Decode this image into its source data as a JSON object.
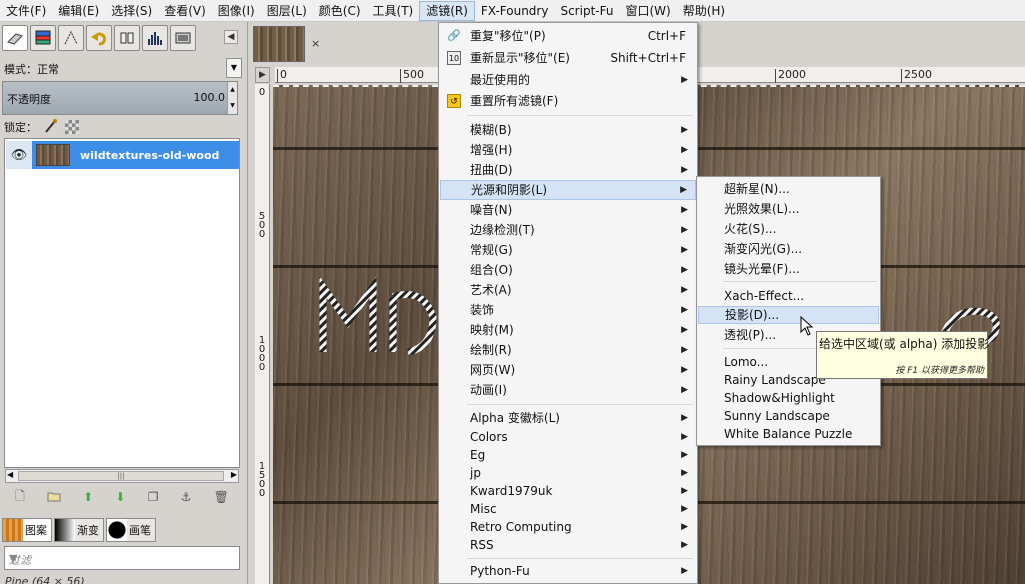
{
  "menubar": [
    {
      "label": "文件(F)"
    },
    {
      "label": "编辑(E)"
    },
    {
      "label": "选择(S)"
    },
    {
      "label": "查看(V)"
    },
    {
      "label": "图像(I)"
    },
    {
      "label": "图层(L)"
    },
    {
      "label": "颜色(C)"
    },
    {
      "label": "工具(T)"
    },
    {
      "label": "滤镜(R)",
      "active": true
    },
    {
      "label": "FX-Foundry"
    },
    {
      "label": "Script-Fu"
    },
    {
      "label": "窗口(W)"
    },
    {
      "label": "帮助(H)"
    }
  ],
  "layers_dock": {
    "mode_label": "模式：",
    "mode_value": "正常",
    "opacity_label": "不透明度",
    "opacity_value": "100.0",
    "lock_label": "锁定：",
    "layer_name": "wildtextures-old-wood",
    "scroll_grip": "|||"
  },
  "patterns_dock": {
    "tabs": [
      {
        "label": "图案"
      },
      {
        "label": "渐变"
      },
      {
        "label": "画笔"
      }
    ],
    "filter_placeholder": "过滤",
    "pattern_name": "Pine (64 × 56)"
  },
  "image_window": {
    "close_glyph": "×",
    "ruler_top": [
      "0",
      "500",
      "2000",
      "2500"
    ],
    "ruler_left": [
      "0",
      "500",
      "1000",
      "1500"
    ]
  },
  "filters_menu": {
    "items": [
      {
        "label": "重复\"移位\"(P)",
        "shortcut": "Ctrl+F"
      },
      {
        "label": "重新显示\"移位\"(E)",
        "shortcut": "Shift+Ctrl+F"
      },
      {
        "label": "最近使用的",
        "submenu": true
      },
      {
        "label": "重置所有滤镜(F)"
      },
      {
        "label": "模糊(B)",
        "submenu": true
      },
      {
        "label": "增强(H)",
        "submenu": true
      },
      {
        "label": "扭曲(D)",
        "submenu": true
      },
      {
        "label": "光源和阴影(L)",
        "submenu": true,
        "highlighted": true
      },
      {
        "label": "噪音(N)",
        "submenu": true
      },
      {
        "label": "边缘检测(T)",
        "submenu": true
      },
      {
        "label": "常规(G)",
        "submenu": true
      },
      {
        "label": "组合(O)",
        "submenu": true
      },
      {
        "label": "艺术(A)",
        "submenu": true
      },
      {
        "label": "装饰",
        "submenu": true
      },
      {
        "label": "映射(M)",
        "submenu": true
      },
      {
        "label": "绘制(R)",
        "submenu": true
      },
      {
        "label": "网页(W)",
        "submenu": true
      },
      {
        "label": "动画(I)",
        "submenu": true
      },
      {
        "label": "Alpha 变徽标(L)",
        "submenu": true
      },
      {
        "label": "Colors",
        "submenu": true
      },
      {
        "label": "Eg",
        "submenu": true
      },
      {
        "label": "jp",
        "submenu": true
      },
      {
        "label": "Kward1979uk",
        "submenu": true
      },
      {
        "label": "Misc",
        "submenu": true
      },
      {
        "label": "Retro Computing",
        "submenu": true
      },
      {
        "label": "RSS",
        "submenu": true
      },
      {
        "label": "Python-Fu",
        "submenu": true
      }
    ]
  },
  "light_shadow_submenu": {
    "items": [
      {
        "label": "超新星(N)..."
      },
      {
        "label": "光照效果(L)..."
      },
      {
        "label": "火花(S)..."
      },
      {
        "label": "渐变闪光(G)..."
      },
      {
        "label": "镜头光晕(F)..."
      },
      {
        "label": "Xach-Effect..."
      },
      {
        "label": "投影(D)...",
        "highlighted": true
      },
      {
        "label": "透视(P)..."
      },
      {
        "label": "Lomo..."
      },
      {
        "label": "Rainy Landscape"
      },
      {
        "label": "Shadow&Highlight"
      },
      {
        "label": "Sunny Landscape"
      },
      {
        "label": "White Balance Puzzle"
      }
    ]
  },
  "tooltip": {
    "text": "给选中区域(或 alpha) 添加投影",
    "hint": "按 F1 以获得更多帮助"
  },
  "colors": {
    "highlight": "#d4e4f6",
    "layer_selected": "#3d8ee6",
    "tooltip_bg": "#ffffe1"
  }
}
